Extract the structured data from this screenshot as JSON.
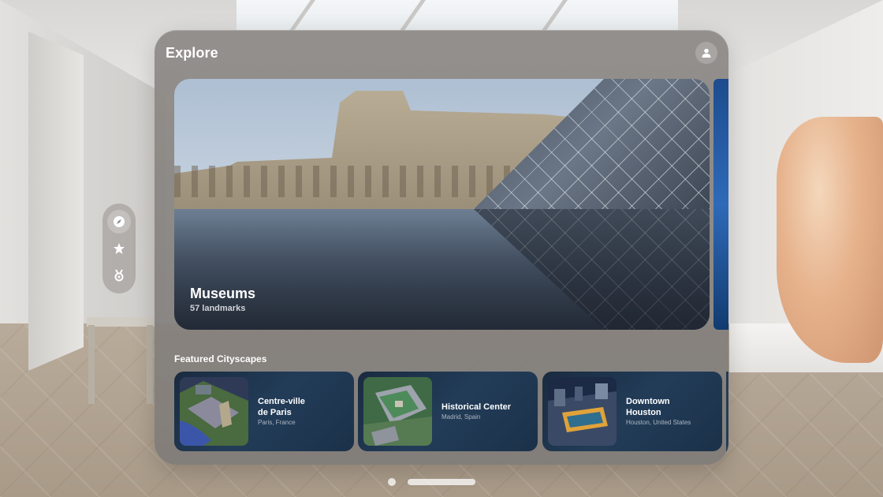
{
  "window": {
    "title": "Explore"
  },
  "hero": {
    "title": "Museums",
    "subtitle": "57 landmarks"
  },
  "featured": {
    "section_title": "Featured Cityscapes",
    "cards": [
      {
        "name_line1": "Centre-ville",
        "name_line2": "de Paris",
        "location": "Paris, France"
      },
      {
        "name_line1": "Historical Center",
        "name_line2": "",
        "location": "Madrid, Spain"
      },
      {
        "name_line1": "Downtown",
        "name_line2": "Houston",
        "location": "Houston, United States"
      }
    ]
  },
  "ornament": {
    "items": [
      {
        "icon": "compass-icon",
        "active": true
      },
      {
        "icon": "star-icon",
        "active": false
      },
      {
        "icon": "medal-icon",
        "active": false
      }
    ]
  },
  "colors": {
    "glass": "#8a8683",
    "card_bg": "#1f3550",
    "text": "#ffffff"
  }
}
